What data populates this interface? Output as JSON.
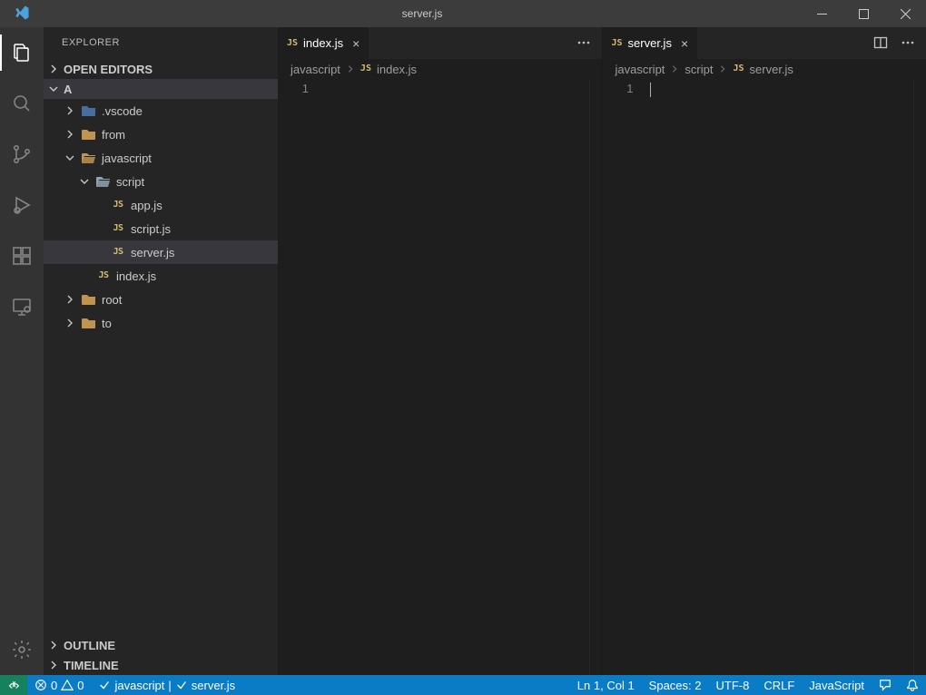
{
  "titlebar": {
    "title": "server.js"
  },
  "activitybar": {
    "items": [
      "explorer",
      "search",
      "scm",
      "debug",
      "extensions",
      "remote-explorer"
    ],
    "bottom": [
      "settings"
    ]
  },
  "sidebar": {
    "title": "EXPLORER",
    "sections": {
      "openEditors": "OPEN EDITORS",
      "workspace": "A",
      "outline": "OUTLINE",
      "timeline": "TIMELINE"
    },
    "tree": [
      {
        "name": ".vscode",
        "type": "folder",
        "icon": "vscode",
        "depth": 1,
        "expanded": false
      },
      {
        "name": "from",
        "type": "folder",
        "depth": 1,
        "expanded": false
      },
      {
        "name": "javascript",
        "type": "folder",
        "depth": 1,
        "expanded": true
      },
      {
        "name": "script",
        "type": "folder",
        "icon": "special",
        "depth": 2,
        "expanded": true
      },
      {
        "name": "app.js",
        "type": "js",
        "depth": 3
      },
      {
        "name": "script.js",
        "type": "js",
        "depth": 3
      },
      {
        "name": "server.js",
        "type": "js",
        "depth": 3,
        "selected": true
      },
      {
        "name": "index.js",
        "type": "js",
        "depth": 2
      },
      {
        "name": "root",
        "type": "folder",
        "depth": 1,
        "expanded": false
      },
      {
        "name": "to",
        "type": "folder",
        "depth": 1,
        "expanded": false
      }
    ]
  },
  "editorGroups": [
    {
      "tabs": [
        {
          "filename": "index.js",
          "icon": "js",
          "active": true
        }
      ],
      "actions": [
        "more"
      ],
      "breadcrumbs": [
        {
          "text": "javascript"
        },
        {
          "icon": "js",
          "text": "index.js"
        }
      ],
      "gutter": [
        "1"
      ],
      "cursor": false
    },
    {
      "tabs": [
        {
          "filename": "server.js",
          "icon": "js",
          "active": true
        }
      ],
      "actions": [
        "split",
        "more"
      ],
      "breadcrumbs": [
        {
          "text": "javascript"
        },
        {
          "text": "script"
        },
        {
          "icon": "js",
          "text": "server.js"
        }
      ],
      "gutter": [
        "1"
      ],
      "cursor": true
    }
  ],
  "statusbar": {
    "left": {
      "errors": "0",
      "warnings": "0",
      "porter_a": "javascript",
      "porter_sep": " | ",
      "porter_b": "server.js"
    },
    "right": {
      "cursor": "Ln 1, Col 1",
      "spaces": "Spaces: 2",
      "encoding": "UTF-8",
      "eol": "CRLF",
      "language": "JavaScript"
    }
  },
  "icons": {
    "js_badge": "JS"
  }
}
